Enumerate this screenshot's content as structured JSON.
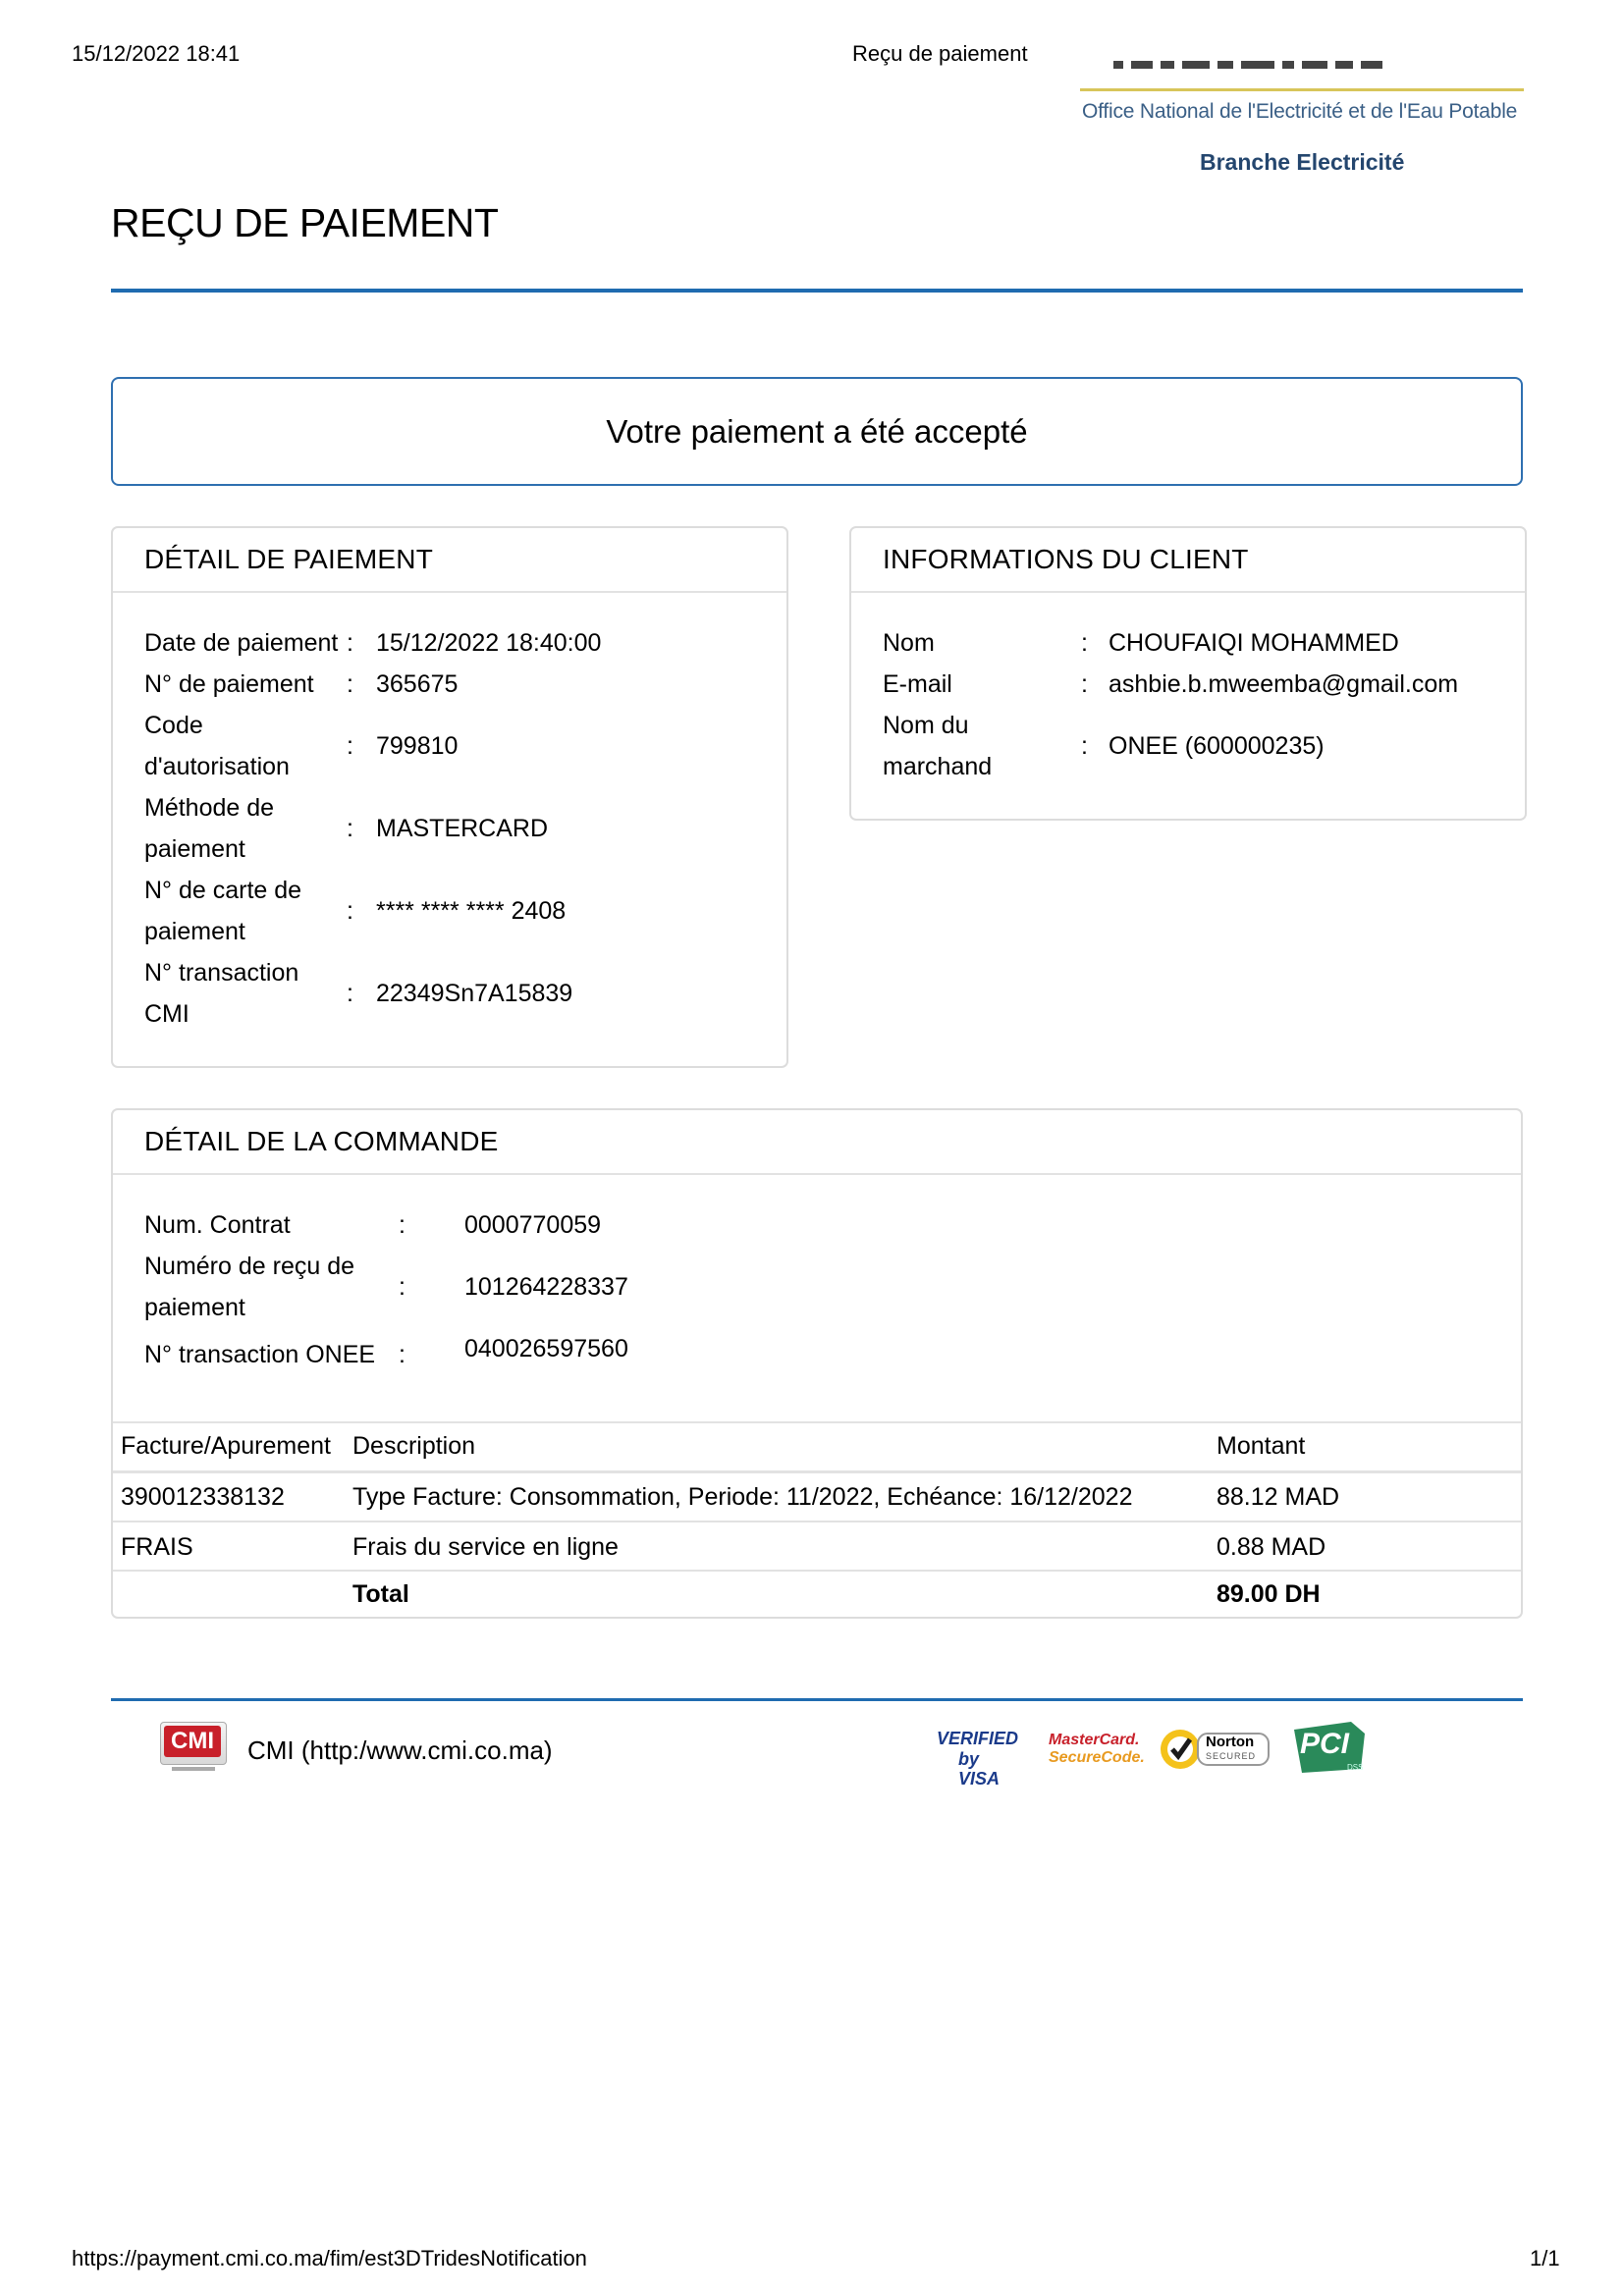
{
  "print_header": {
    "datetime": "15/12/2022 18:41",
    "title": "Reçu de paiement"
  },
  "logo": {
    "office": "Office National de l'Electricité et de l'Eau Potable",
    "branche": "Branche Electricité"
  },
  "page_title": "REÇU DE PAIEMENT",
  "status_message": "Votre paiement a été accepté",
  "payment_detail": {
    "heading": "DÉTAIL DE PAIEMENT",
    "rows": [
      {
        "label": "Date de paiement",
        "value": "15/12/2022 18:40:00"
      },
      {
        "label": "N° de paiement",
        "value": "365675"
      },
      {
        "label_lines": [
          "Code",
          "d'autorisation"
        ],
        "value": "799810"
      },
      {
        "label_lines": [
          "Méthode de",
          "paiement"
        ],
        "value": "MASTERCARD"
      },
      {
        "label_lines": [
          "N° de carte de",
          "paiement"
        ],
        "value": "**** **** **** 2408"
      },
      {
        "label_lines": [
          "N° transaction",
          "CMI"
        ],
        "value": "22349Sn7A15839"
      }
    ]
  },
  "client_info": {
    "heading": "INFORMATIONS DU CLIENT",
    "rows": [
      {
        "label": "Nom",
        "value": "CHOUFAIQI MOHAMMED"
      },
      {
        "label": "E-mail",
        "value": "ashbie.b.mweemba@gmail.com"
      },
      {
        "label_lines": [
          "Nom du",
          "marchand"
        ],
        "value": "ONEE (600000235)"
      }
    ]
  },
  "order_detail": {
    "heading": "DÉTAIL DE LA COMMANDE",
    "rows": [
      {
        "label": "Num. Contrat",
        "value": "0000770059"
      },
      {
        "label_lines": [
          "Numéro de reçu de",
          "paiement"
        ],
        "value": "101264228337"
      },
      {
        "label": "N° transaction ONEE",
        "value": "040026597560"
      }
    ],
    "table": {
      "headers": [
        "Facture/Apurement",
        "Description",
        "Montant"
      ],
      "rows": [
        [
          "390012338132",
          "Type Facture: Consommation, Periode: 11/2022, Echéance: 16/12/2022",
          "88.12 MAD"
        ],
        [
          "FRAIS",
          "Frais du service en ligne",
          "0.88 MAD"
        ]
      ],
      "total_label": "Total",
      "total_value": "89.00 DH"
    }
  },
  "footer": {
    "cmi_logo": "CMI",
    "cmi_link": "CMI (http:/www.cmi.co.ma)",
    "badges": {
      "visa_line1": "VERIFIED",
      "visa_line2": "by VISA",
      "mc_line1": "MasterCard.",
      "mc_line2": "SecureCode.",
      "norton_line1": "Norton",
      "norton_line2": "SECURED",
      "pci": "PCI",
      "pci_small": "DSS"
    }
  },
  "print_footer": {
    "url": "https://payment.cmi.co.ma/fim/est3DTridesNotification",
    "page": "1/1"
  },
  "colors": {
    "accent_blue": "#1f6bb0",
    "panel_border": "#dcdcdc"
  }
}
